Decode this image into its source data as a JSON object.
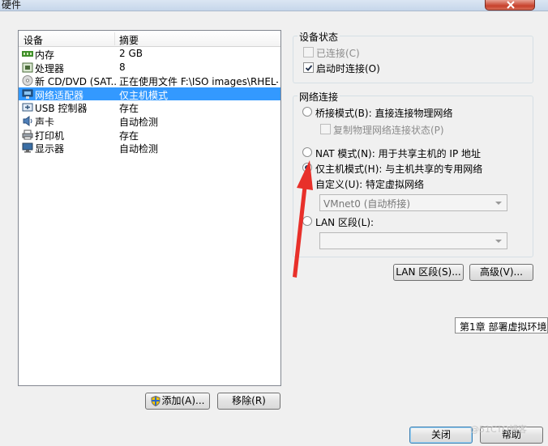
{
  "window": {
    "title": "硬件"
  },
  "devices": {
    "header": {
      "device": "设备",
      "summary": "摘要"
    },
    "rows": [
      {
        "name": "内存",
        "summary": "2 GB",
        "icon": "memory-icon"
      },
      {
        "name": "处理器",
        "summary": "8",
        "icon": "cpu-icon"
      },
      {
        "name": "新 CD/DVD (SAT...",
        "summary": "正在使用文件 F:\\ISO images\\RHEL-s...",
        "icon": "cd-dvd-icon"
      },
      {
        "name": "网络适配器",
        "summary": "仅主机模式",
        "icon": "network-adapter-icon",
        "selected": true
      },
      {
        "name": "USB 控制器",
        "summary": "存在",
        "icon": "usb-icon"
      },
      {
        "name": "声卡",
        "summary": "自动检测",
        "icon": "sound-card-icon"
      },
      {
        "name": "打印机",
        "summary": "存在",
        "icon": "printer-icon"
      },
      {
        "name": "显示器",
        "summary": "自动检测",
        "icon": "monitor-icon"
      }
    ],
    "add_label": "添加(A)...",
    "remove_label": "移除(R)"
  },
  "device_status": {
    "title": "设备状态",
    "connected": {
      "label": "已连接(C)",
      "checked": false,
      "enabled": false
    },
    "connect_on_power": {
      "label": "启动时连接(O)",
      "checked": true
    }
  },
  "network": {
    "title": "网络连接",
    "bridged": {
      "label": "桥接模式(B): 直接连接物理网络",
      "checked": false
    },
    "replicate": {
      "label": "复制物理网络连接状态(P)",
      "checked": false,
      "enabled": false
    },
    "nat": {
      "label": "NAT 模式(N): 用于共享主机的 IP 地址",
      "checked": false
    },
    "host_only": {
      "label": "仅主机模式(H): 与主机共享的专用网络",
      "checked": true
    },
    "custom": {
      "label": "自定义(U): 特定虚拟网络",
      "checked": false
    },
    "custom_value": "VMnet0 (自动桥接)",
    "lan_segment": {
      "label": "LAN 区段(L):",
      "checked": false
    },
    "lan_value": ""
  },
  "buttons": {
    "lan_segments": "LAN 区段(S)...",
    "advanced": "高级(V)...",
    "close": "关闭",
    "help": "帮助"
  },
  "tooltip": "第1章 部署虚拟环境",
  "watermark": "@51CTO博客",
  "colors": {
    "selection": "#3399ff",
    "annotation_arrow": "#e8302a"
  }
}
